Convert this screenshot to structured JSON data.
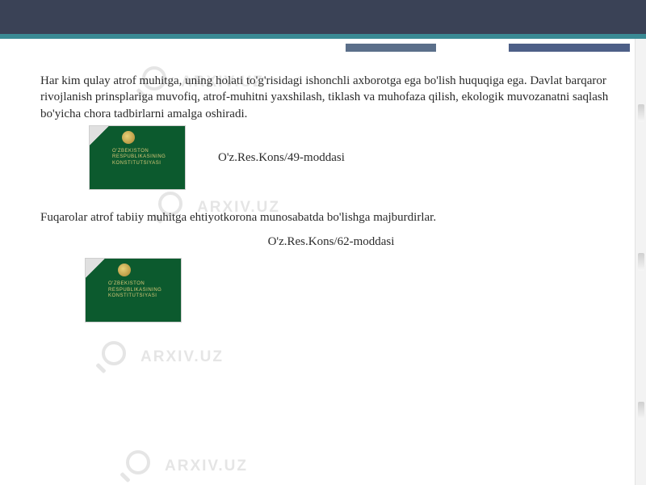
{
  "watermark": {
    "text": "ARXIV.UZ"
  },
  "paragraphs": {
    "p1": "Har kim qulay atrof muhitga, uning holati to'g'risidagi ishonchli axborotga ega bo'lish huquqiga ega. Davlat barqaror rivojlanish prinsplariga muvofiq, atrof-muhitni yaxshilash, tiklash va muhofaza qilish, ekologik muvozanatni saqlash bo'yicha chora tadbirlarni amalga oshiradi.",
    "cite1": "O'z.Res.Kons/49-moddasi",
    "p2": "Fuqarolar atrof tabiiy muhitga ehtiyotkorona munosabatda bo'lishga majburdirlar.",
    "cite2": "O'z.Res.Kons/62-moddasi"
  },
  "book_cover": {
    "line1": "O'ZBEKISTON",
    "line2": "RESPUBLIKASINING",
    "line3": "KONSTITUTSIYASI"
  },
  "colors": {
    "header": "#3a4256",
    "teal": "#3a8a94",
    "book_green": "#0c5a2e",
    "gold": "#d8c878"
  }
}
